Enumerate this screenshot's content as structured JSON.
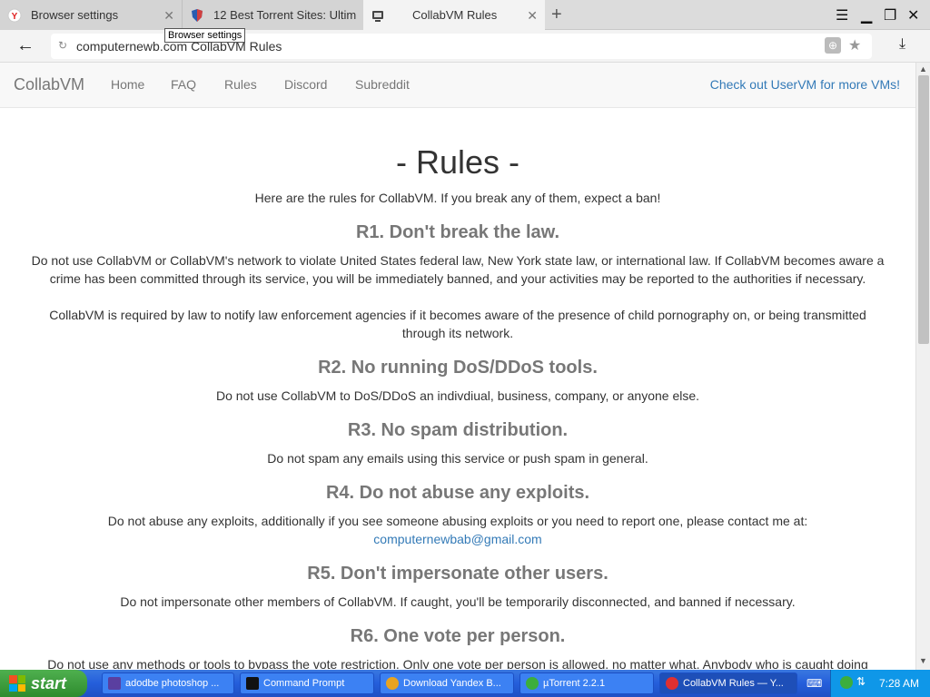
{
  "browser": {
    "tabs": [
      {
        "label": "Browser settings"
      },
      {
        "label": "12 Best Torrent Sites: Ultim"
      },
      {
        "label": "CollabVM Rules"
      }
    ],
    "tooltip": "Browser settings",
    "url_domain": "computernewb.com",
    "url_title": "CollabVM Rules"
  },
  "site": {
    "brand": "CollabVM",
    "nav": [
      "Home",
      "FAQ",
      "Rules",
      "Discord",
      "Subreddit"
    ],
    "nav_right": "Check out UserVM for more VMs!"
  },
  "page": {
    "title": "- Rules -",
    "intro": "Here are the rules for CollabVM. If you break any of them, expect a ban!",
    "rules": [
      {
        "heading": "R1. Don't break the law.",
        "p1": "Do not use CollabVM or CollabVM's network to violate United States federal law, New York state law, or international law. If CollabVM becomes aware a crime has been committed through its service, you will be immediately banned, and your activities may be reported to the authorities if necessary.",
        "p2": "CollabVM is required by law to notify law enforcement agencies if it becomes aware of the presence of child pornography on, or being transmitted through its network."
      },
      {
        "heading": "R2. No running DoS/DDoS tools.",
        "p1": "Do not use CollabVM to DoS/DDoS an indivdiual, business, company, or anyone else."
      },
      {
        "heading": "R3. No spam distribution.",
        "p1": "Do not spam any emails using this service or push spam in general."
      },
      {
        "heading": "R4. Do not abuse any exploits.",
        "p1": "Do not abuse any exploits, additionally if you see someone abusing exploits or you need to report one, please contact me at:",
        "email": "computernewbab@gmail.com"
      },
      {
        "heading": "R5. Don't impersonate other users.",
        "p1": "Do not impersonate other members of CollabVM. If caught, you'll be temporarily disconnected, and banned if necessary."
      },
      {
        "heading": "R6. One vote per person.",
        "p1": "Do not use any methods or tools to bypass the vote restriction. Only one vote per person is allowed, no matter what. Anybody who is caught doing"
      }
    ]
  },
  "taskbar": {
    "start": "start",
    "tasks": [
      {
        "label": "adodbe photoshop ...",
        "color": "#5a3fa0"
      },
      {
        "label": "Command Prompt",
        "color": "#111111"
      },
      {
        "label": "Download Yandex B...",
        "color": "#e8a321"
      },
      {
        "label": "µTorrent 2.2.1",
        "color": "#3cae3c"
      },
      {
        "label": "CollabVM Rules — Y...",
        "color": "#e03030"
      }
    ],
    "clock": "7:28 AM"
  },
  "colors": {
    "accent_link": "#337ab7",
    "heading_gray": "#777777"
  }
}
